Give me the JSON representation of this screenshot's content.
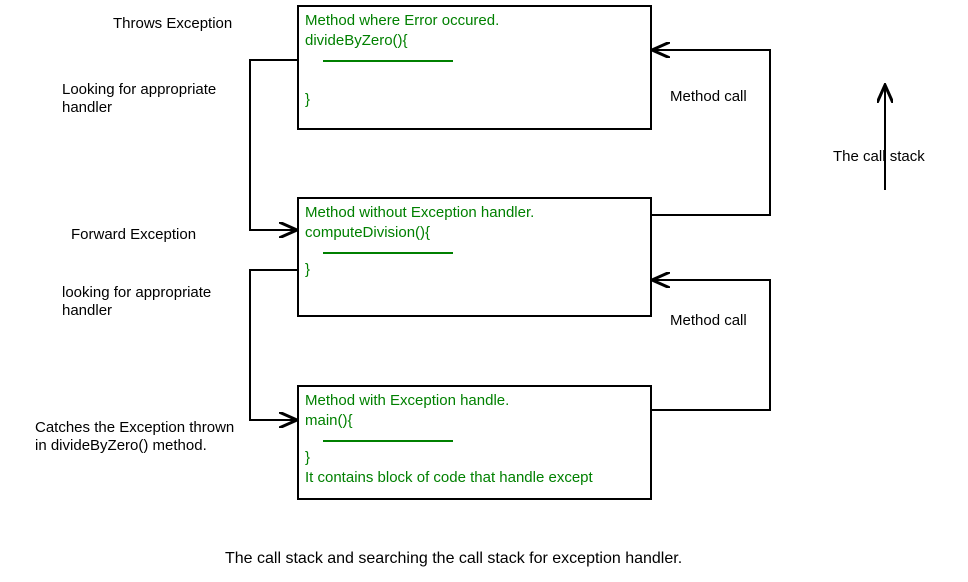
{
  "labels": {
    "throws": "Throws Exception",
    "looking1a": "Looking for appropriate",
    "looking1b": "handler",
    "forward": "Forward Exception",
    "looking2a": "looking for appropriate",
    "looking2b": "handler",
    "catches1": "Catches the Exception thrown",
    "catches2": "in divideByZero() method.",
    "methodcall1": "Method call",
    "methodcall2": "Method call",
    "callstack": "The call stack"
  },
  "box1": {
    "l1": "Method where Error occured.",
    "l2": "divideByZero(){",
    "l3": "}"
  },
  "box2": {
    "l1": "Method without Exception handler.",
    "l2": "computeDivision(){",
    "l3": "}"
  },
  "box3": {
    "l1": "Method with Exception handle.",
    "l2": "main(){",
    "l3": "}",
    "l4": "It contains block of code that handle except"
  },
  "caption": "The call stack and searching the call stack for exception handler."
}
